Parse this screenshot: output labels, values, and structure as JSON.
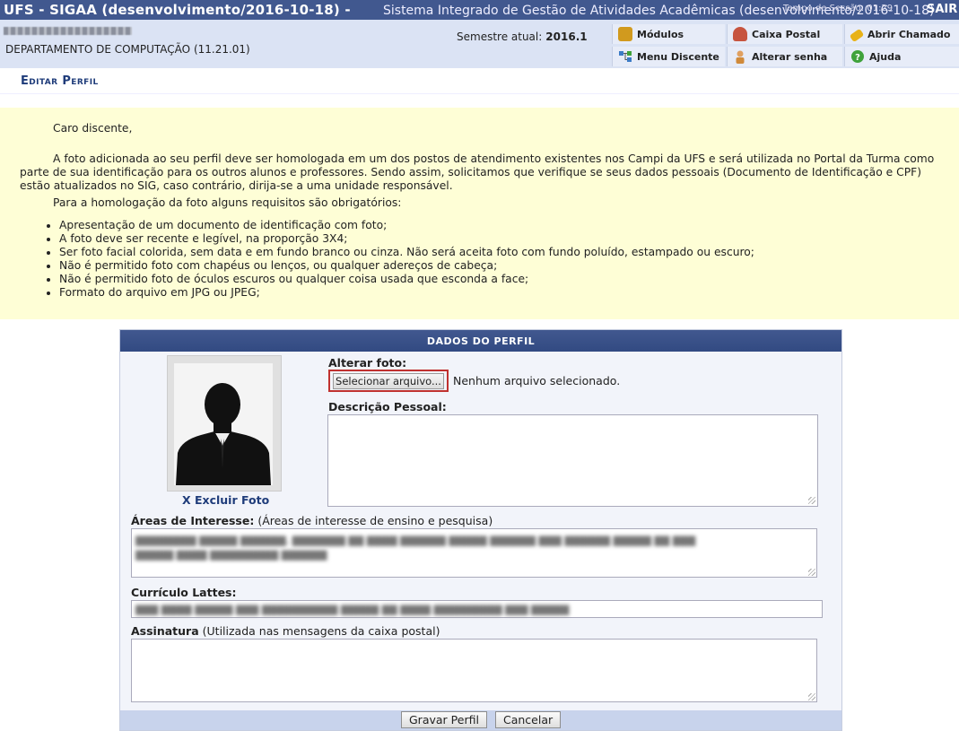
{
  "topbar": {
    "app_title": "UFS - SIGAA (desenvolvimento/2016-10-18) -",
    "system_name": "Sistema Integrado de Gestão de Atividades Acadêmicas (desenvolvimento/2016-10-18)",
    "session_timer": "Tempo de Sessão: 01:29",
    "logout": "SAIR"
  },
  "header": {
    "department": "DEPARTAMENTO DE COMPUTAÇÃO (11.21.01)",
    "semester_label": "Semestre atual:",
    "semester_value": "2016.1",
    "menu": [
      {
        "label": "Módulos",
        "icon": "modules-box-icon",
        "color": "#d19a1e"
      },
      {
        "label": "Caixa Postal",
        "icon": "mailbox-icon",
        "color": "#c7543f"
      },
      {
        "label": "Abrir Chamado",
        "icon": "flashlight-icon",
        "color": "#e8b218"
      },
      {
        "label": "Menu Discente",
        "icon": "menu-tree-icon",
        "color": "#3b7bc6"
      },
      {
        "label": "Alterar senha",
        "icon": "user-key-icon",
        "color": "#d08a3a"
      },
      {
        "label": "Ajuda",
        "icon": "help-icon",
        "color": "#3fa23b"
      }
    ]
  },
  "page_title": "Editar Perfil",
  "notice": {
    "greeting": "Caro discente,",
    "paragraph_1": "A foto adicionada ao seu perfil deve ser homologada em um dos postos de atendimento existentes nos Campi da UFS e será utilizada no Portal da Turma como parte de sua identificação para os outros alunos e professores. Sendo assim, solicitamos que verifique se seus dados pessoais (Documento de Identificação e CPF) estão atualizados no SIG, caso contrário, dirija-se a uma unidade responsável.",
    "paragraph_2": "Para a homologação da foto alguns requisitos são obrigatórios:",
    "requirements": [
      "Apresentação de um documento de identificação com foto;",
      "A foto deve ser recente e legível, na proporção 3X4;",
      "Ser foto facial colorida, sem data e em fundo branco ou cinza. Não será aceita foto com fundo poluído, estampado ou escuro;",
      "Não é permitido foto com chapéus ou lenços, ou qualquer adereços de cabeça;",
      "Não é permitido foto de óculos escuros ou qualquer coisa usada que esconda a face;",
      "Formato do arquivo em JPG ou JPEG;"
    ]
  },
  "form": {
    "caption": "DADOS DO PERFIL",
    "delete_photo": "X Excluir Foto",
    "change_photo_label": "Alterar foto:",
    "file_button": "Selecionar arquivo...",
    "no_file": "Nenhum arquivo selecionado.",
    "description_label": "Descrição Pessoal:",
    "interests_label": "Áreas de Interesse:",
    "interests_hint": "(Áreas de interesse de ensino e pesquisa)",
    "lattes_label": "Currículo Lattes:",
    "signature_label": "Assinatura",
    "signature_hint": "(Utilizada nas mensagens da caixa postal)",
    "save_button": "Gravar Perfil",
    "cancel_button": "Cancelar"
  },
  "colors": {
    "topbar": "#41588f",
    "header_bg": "#dbe3f4",
    "notice_bg": "#fefed6",
    "title_text": "#1f3c7a",
    "highlight_border": "#c0312f"
  }
}
